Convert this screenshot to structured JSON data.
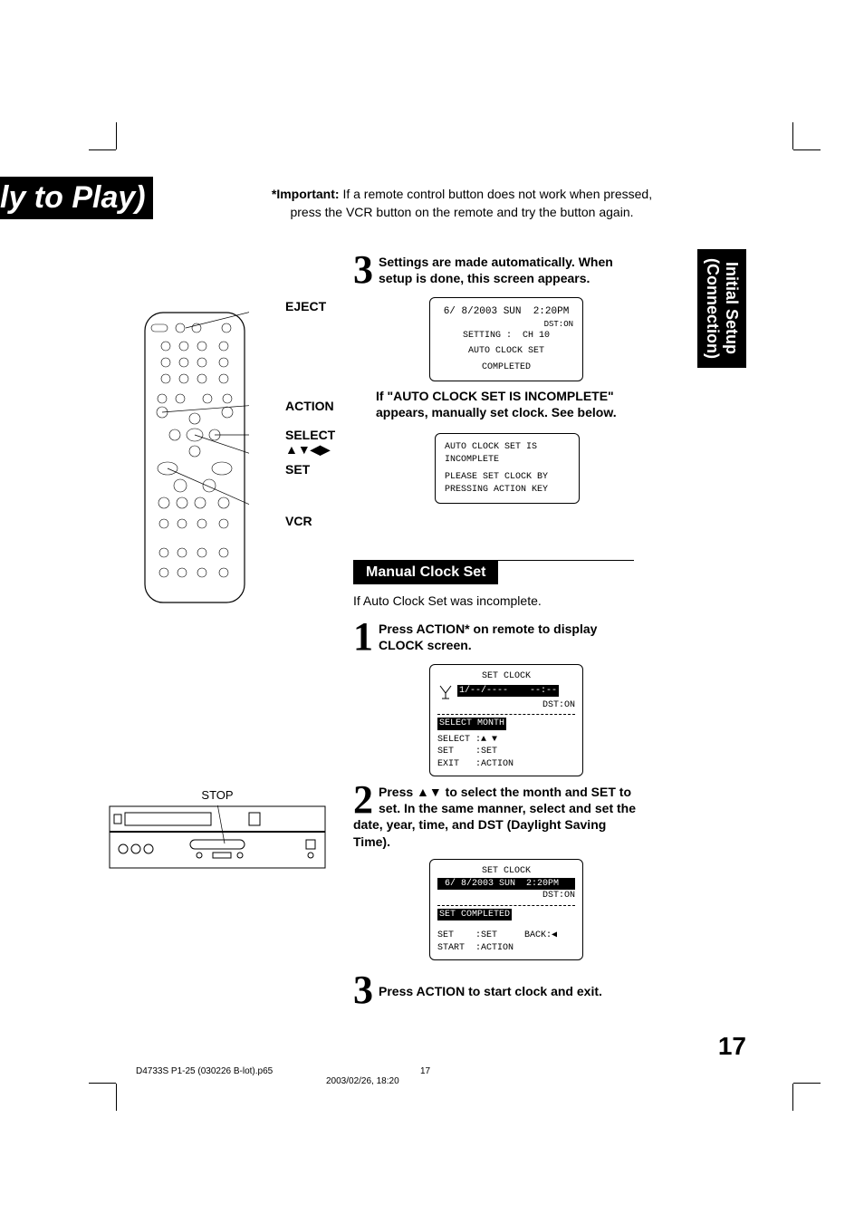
{
  "header": {
    "cutoff_title": "ly to Play)",
    "important_label": "*Important:",
    "important_text_1": " If a remote control button does not work when pressed,",
    "important_text_2": "press the VCR button on the remote and try the button again."
  },
  "side_tab": {
    "line1": "Initial Setup",
    "line2": "(Connection)"
  },
  "remote_labels": {
    "eject": "EJECT",
    "action": "ACTION",
    "select": "SELECT",
    "select_arrows": "▲▼◀▶",
    "set": "SET",
    "vcr": "VCR"
  },
  "auto_step3": {
    "num": "3",
    "text": "Settings are made automatically. When setup is done, this screen appears."
  },
  "osd_completed": {
    "l1": "6/ 8/2003 SUN  2:20PM",
    "l2": "DST:ON",
    "l3": "SETTING :  CH 10",
    "l4": "AUTO CLOCK SET",
    "l5": "COMPLETED"
  },
  "incomplete_note": "If \"AUTO CLOCK SET IS INCOMPLETE\" appears, manually set clock. See below.",
  "osd_incomplete": {
    "l1": "AUTO CLOCK SET IS",
    "l2": "INCOMPLETE",
    "l3": "PLEASE SET CLOCK BY",
    "l4": "PRESSING ACTION KEY"
  },
  "manual_section": {
    "title": "Manual Clock Set",
    "intro": "If Auto Clock Set was incomplete."
  },
  "manual_step1": {
    "num": "1",
    "text": "Press ACTION* on remote to display CLOCK screen."
  },
  "osd_clock1": {
    "title": "SET CLOCK",
    "row_date": "1/--/----    --:--",
    "dst": "DST:ON",
    "highlight": "SELECT MONTH",
    "s1": "SELECT :▲ ▼",
    "s2": "SET    :SET",
    "s3": "EXIT   :ACTION"
  },
  "manual_step2": {
    "num": "2",
    "text_a": "Press ",
    "arrows": "▲▼",
    "text_b": " to select the month and SET to set. In the same manner, select and set the date, year, time, and DST (Daylight Saving Time)."
  },
  "osd_clock2": {
    "title": "SET CLOCK",
    "row_inv": " 6/ 8/2003 SUN  2:20PM",
    "dst": "DST:ON",
    "highlight": "SET COMPLETED",
    "s1": "SET    :SET     BACK:◀",
    "s2": "START  :ACTION"
  },
  "manual_step3": {
    "num": "3",
    "text": "Press ACTION to start clock and exit."
  },
  "vcr_front": {
    "stop": "STOP"
  },
  "page_number": "17",
  "footer": {
    "file": "D4733S P1-25 (030226 B-lot).p65",
    "page": "17",
    "timestamp": "2003/02/26, 18:20"
  }
}
